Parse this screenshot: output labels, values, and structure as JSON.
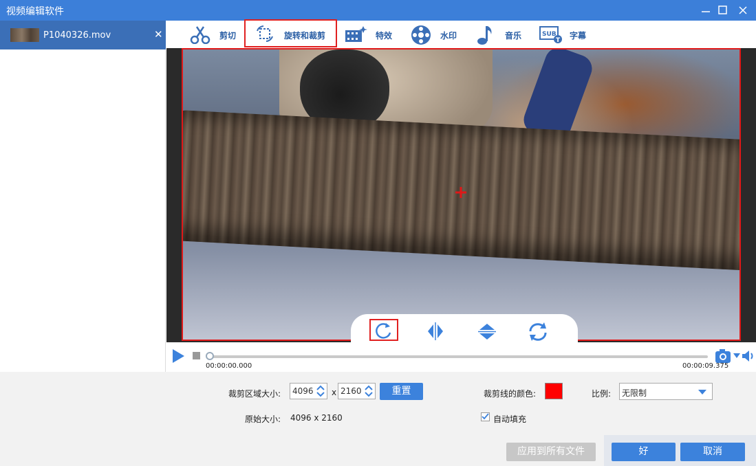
{
  "window": {
    "title": "视频编辑软件"
  },
  "sidebar": {
    "file": {
      "name": "P1040326.mov",
      "close": "✕"
    }
  },
  "tabs": [
    {
      "label": "剪切",
      "icon": "scissors-icon"
    },
    {
      "label": "旋转和裁剪",
      "icon": "crop-rotate-icon"
    },
    {
      "label": "特效",
      "icon": "effects-icon"
    },
    {
      "label": "水印",
      "icon": "watermark-icon"
    },
    {
      "label": "音乐",
      "icon": "music-note-icon"
    },
    {
      "label": "字幕",
      "icon": "subtitle-icon"
    }
  ],
  "player": {
    "current_time": "00:00:00.000",
    "duration": "00:00:09.375",
    "progress": 0.0
  },
  "crop": {
    "area_label": "裁剪区域大小:",
    "width": "4096",
    "x_sep": "x",
    "height": "2160",
    "reset_label": "重置",
    "original_label": "原始大小:",
    "original_value": "4096 x 2160",
    "line_color_label": "裁剪线的颜色:",
    "line_color": "#ff0000",
    "ratio_label": "比例:",
    "ratio_value": "无限制",
    "autofill_label": "自动填充",
    "autofill_checked": true
  },
  "buttons": {
    "apply_all": "应用到所有文件",
    "ok": "好",
    "cancel": "取消"
  },
  "colors": {
    "accent": "#3c82dc",
    "titlebar": "#3c7fd9",
    "highlight": "#e02020"
  }
}
